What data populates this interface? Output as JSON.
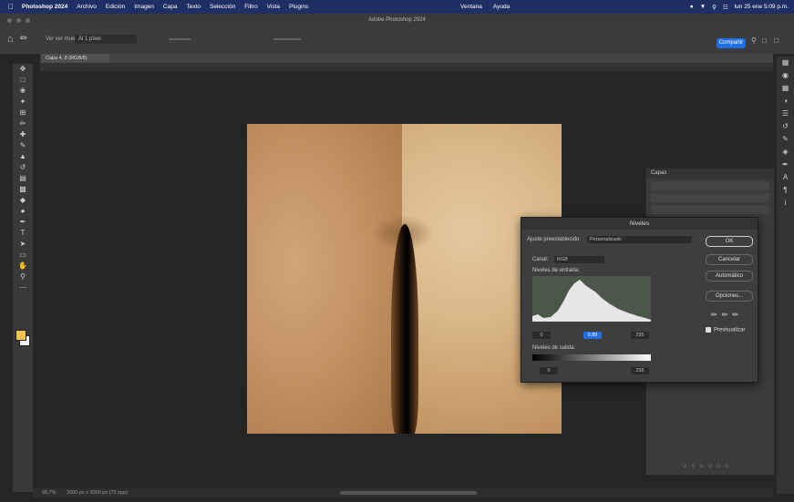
{
  "menubar": {
    "app": "Photoshop 2024",
    "items": [
      "Archivo",
      "Edición",
      "Imagen",
      "Capa",
      "Texto",
      "Selección",
      "Filtro",
      "Vista",
      "Plugins"
    ],
    "extra": [
      "Ventana",
      "Ayuda"
    ],
    "clock": "lun 25 ene 5:09 p.m."
  },
  "window": {
    "title": "Adobe Photoshop 2024"
  },
  "options": {
    "label": "Ver ver muestra",
    "sample_select": "Al 1 píxel",
    "share_label": "Compartir"
  },
  "document": {
    "tab_label": "Capa 4, 8 (RGB/8)"
  },
  "levels": {
    "title": "Niveles",
    "preset_label": "Ajuste preestablecido:",
    "preset_value": "Personalizado",
    "channel_label": "Canal:",
    "channel_value": "RGB",
    "input_label": "Niveles de entrada:",
    "input_values": [
      "0",
      "0,89",
      "255"
    ],
    "output_label": "Niveles de salida:",
    "output_values": [
      "0",
      "255"
    ],
    "buttons": {
      "ok": "OK",
      "cancel": "Cancelar",
      "auto": "Automático",
      "options": "Opciones..."
    },
    "preview_label": "Previsualizar"
  },
  "layers": {
    "title": "Capas"
  },
  "status": {
    "zoom": "66,7%",
    "info": "3000 px x 3000 px (72 ppp)"
  },
  "colors": {
    "menubar": "#1f2f63",
    "accent": "#1f6fe5",
    "foreground": "#f7c34a",
    "background": "#f0f0f0"
  },
  "icons": {
    "tools": [
      "move-icon",
      "marquee-icon",
      "lasso-icon",
      "magic-wand-icon",
      "crop-icon",
      "eyedropper-icon",
      "healing-icon",
      "brush-icon",
      "stamp-icon",
      "history-brush-icon",
      "eraser-icon",
      "gradient-icon",
      "blur-icon",
      "dodge-icon",
      "pen-icon",
      "type-icon",
      "path-select-icon",
      "shape-icon",
      "hand-icon",
      "zoom-icon",
      "more-icon"
    ],
    "panels": [
      "layers-panel-icon",
      "color-icon",
      "swatches-icon",
      "adjustments-icon",
      "properties-icon",
      "history-icon",
      "brush-settings-icon",
      "channels-icon",
      "paths-icon",
      "character-icon",
      "paragraph-icon",
      "info-icon"
    ]
  }
}
